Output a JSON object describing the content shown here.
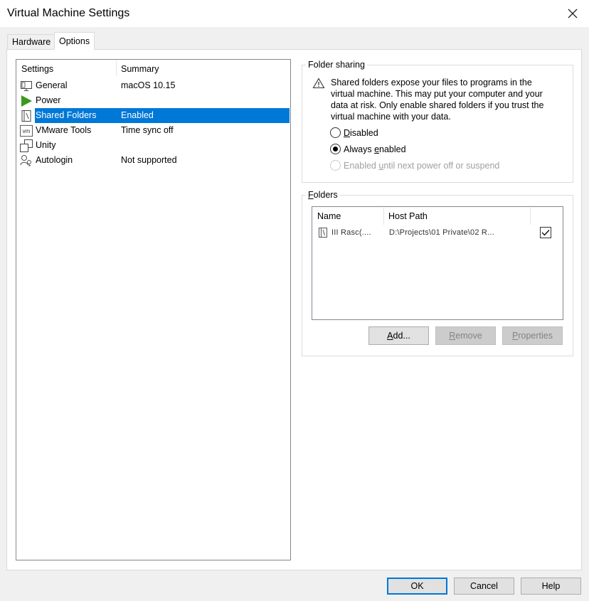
{
  "window": {
    "title": "Virtual Machine Settings"
  },
  "tabs": [
    {
      "label": "Hardware",
      "active": false
    },
    {
      "label": "Options",
      "active": true
    }
  ],
  "settings_list": {
    "columns": [
      "Settings",
      "Summary"
    ],
    "rows": [
      {
        "icon": "monitor-icon",
        "name": "General",
        "summary": "macOS 10.15"
      },
      {
        "icon": "play-icon",
        "name": "Power",
        "summary": ""
      },
      {
        "icon": "shared-folder-icon",
        "name": "Shared Folders",
        "summary": "Enabled",
        "selected": true
      },
      {
        "icon": "vmware-tools-icon",
        "name": "VMware Tools",
        "summary": "Time sync off"
      },
      {
        "icon": "unity-icon",
        "name": "Unity",
        "summary": ""
      },
      {
        "icon": "autologin-icon",
        "name": "Autologin",
        "summary": "Not supported"
      }
    ]
  },
  "folder_sharing": {
    "title": "Folder sharing",
    "warning": "Shared folders expose your files to programs in the virtual machine. This may put your computer and your data at risk. Only enable shared folders if you trust the virtual machine with your data.",
    "options": [
      {
        "pre": "",
        "ul": "D",
        "post": "isabled",
        "checked": false,
        "enabled": true
      },
      {
        "pre": "Always ",
        "ul": "e",
        "post": "nabled",
        "checked": true,
        "enabled": true
      },
      {
        "pre": "Enabled ",
        "ul": "u",
        "post": "ntil next power off or suspend",
        "checked": false,
        "enabled": false
      }
    ]
  },
  "folders": {
    "title_ul": "F",
    "title_rest": "olders",
    "columns": [
      "Name",
      "Host Path"
    ],
    "rows": [
      {
        "name": "III Rasc(....",
        "host_path": "D:\\Projects\\01 Private\\02 R...",
        "checked": true
      }
    ],
    "buttons": {
      "add": {
        "ul": "A",
        "rest": "dd..."
      },
      "remove": {
        "ul": "R",
        "rest": "emove"
      },
      "properties": {
        "ul": "P",
        "rest": "roperties"
      }
    }
  },
  "footer": {
    "ok": "OK",
    "cancel": "Cancel",
    "help": "Help"
  },
  "colors": {
    "selection": "#0078d7",
    "power_icon": "#3a9a1e"
  }
}
